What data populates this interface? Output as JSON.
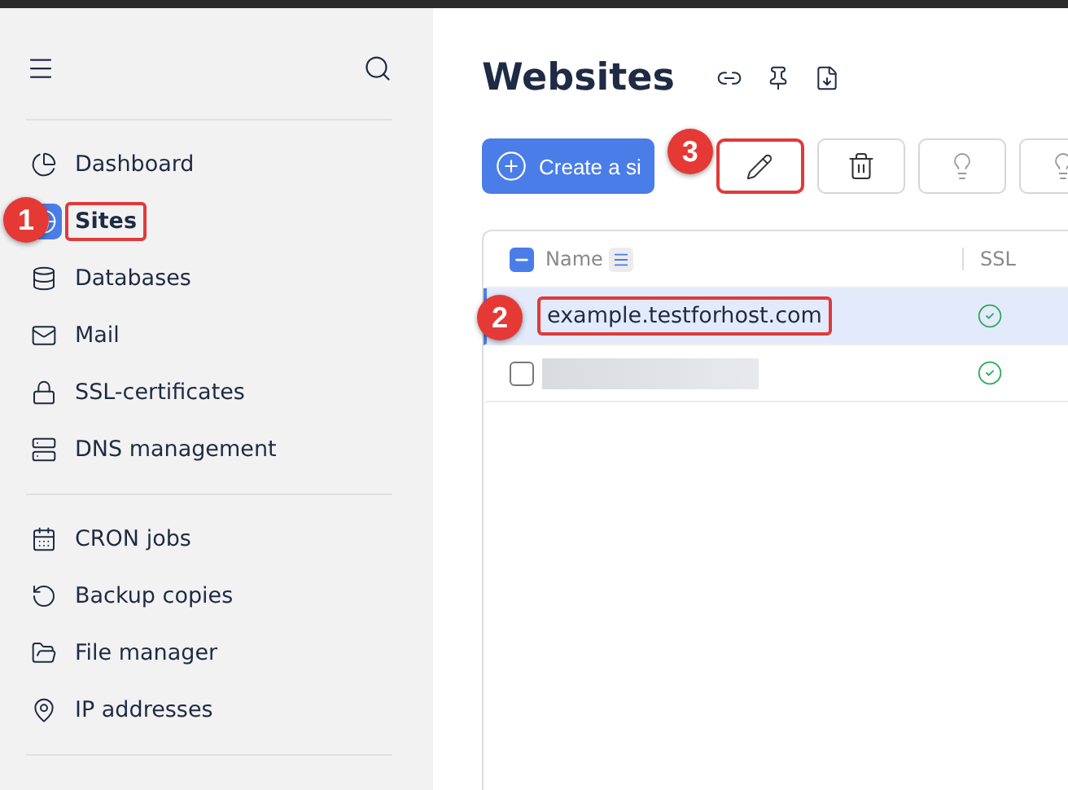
{
  "sidebar": {
    "groups": [
      {
        "items": [
          {
            "label": "Dashboard",
            "selected": false
          },
          {
            "label": "Sites",
            "selected": true,
            "annotation": "1"
          },
          {
            "label": "Databases",
            "selected": false
          },
          {
            "label": "Mail",
            "selected": false
          },
          {
            "label": "SSL-certificates",
            "selected": false
          },
          {
            "label": "DNS management",
            "selected": false
          }
        ]
      },
      {
        "items": [
          {
            "label": "CRON jobs",
            "selected": false
          },
          {
            "label": "Backup copies",
            "selected": false
          },
          {
            "label": "File manager",
            "selected": false
          },
          {
            "label": "IP addresses",
            "selected": false
          }
        ]
      }
    ]
  },
  "page": {
    "title": "Websites"
  },
  "toolbar": {
    "create_label": "Create a si",
    "edit_annotation": "3"
  },
  "table": {
    "columns": [
      "Name",
      "SSL"
    ],
    "select_all": {
      "checked": true,
      "indeterminate": true
    },
    "rows": [
      {
        "kind": "text",
        "name": "example.testforhost.com",
        "selected": true,
        "ssl": true,
        "annotation": "2"
      },
      {
        "kind": "redacted",
        "selected": false,
        "ssl": true
      }
    ]
  }
}
